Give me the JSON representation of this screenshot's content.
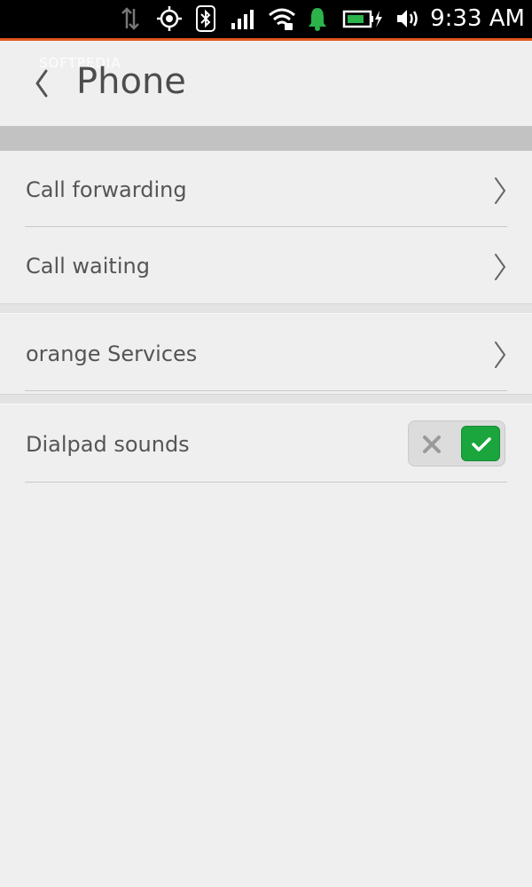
{
  "status_bar": {
    "time": "9:33 AM",
    "icons": [
      "data-transfer-icon",
      "location-icon",
      "bluetooth-icon",
      "signal-icon",
      "wifi-icon",
      "notification-bell-icon",
      "battery-charging-icon",
      "volume-icon"
    ],
    "accent_color": "#e2561e",
    "bell_color": "#2cb34a",
    "battery_fill_color": "#2cb34a"
  },
  "header": {
    "title": "Phone",
    "watermark": "SOFTPEDIA"
  },
  "settings": {
    "items": [
      {
        "label": "Call forwarding",
        "control": "chevron"
      },
      {
        "label": "Call waiting",
        "control": "chevron"
      },
      {
        "label": "orange Services",
        "control": "chevron"
      },
      {
        "label": "Dialpad sounds",
        "control": "toggle",
        "value": true
      }
    ]
  },
  "colors": {
    "background": "#efefef",
    "section_band": "#c2c2c2",
    "toggle_on": "#1aa63c",
    "text": "#555555"
  }
}
